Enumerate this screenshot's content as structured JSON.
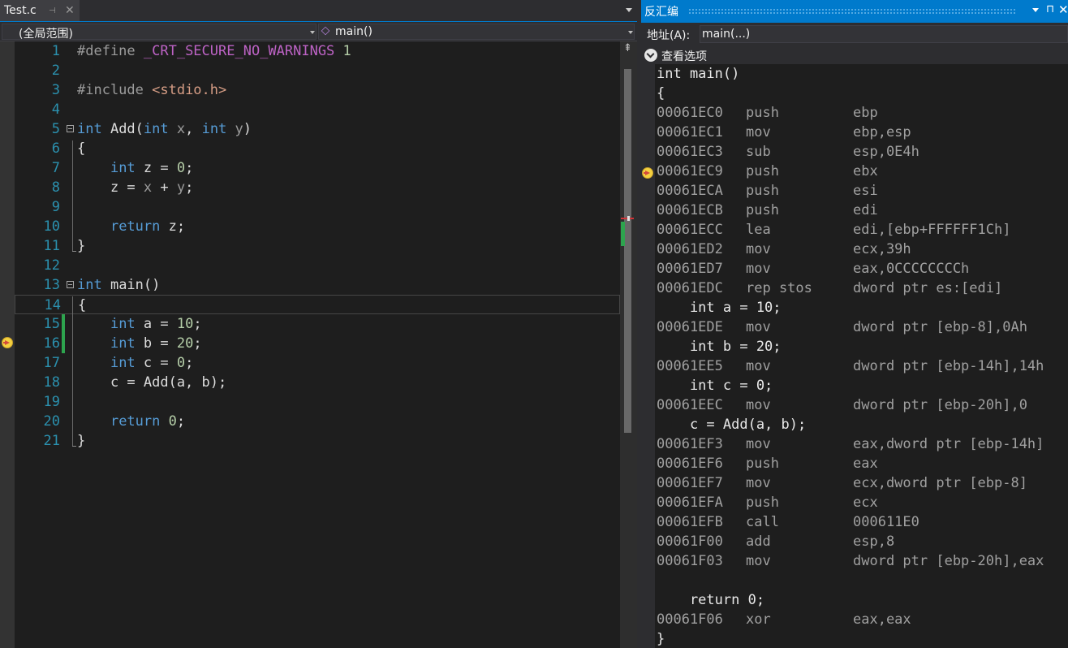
{
  "editor": {
    "tab_title": "Test.c",
    "tab_pin": "⊣",
    "tab_close": "✕",
    "scope_dropdown": "(全局范围)",
    "function_dropdown": "main()",
    "lines": [
      {
        "n": "1",
        "tokens": [
          [
            "pp",
            "#define "
          ],
          [
            "mac",
            "_CRT_SECURE_NO_WARNINGS"
          ],
          [
            "grn",
            " "
          ],
          [
            "n",
            "1"
          ]
        ]
      },
      {
        "n": "2",
        "tokens": []
      },
      {
        "n": "3",
        "tokens": [
          [
            "pp",
            "#include "
          ],
          [
            "str",
            "<stdio.h>"
          ]
        ]
      },
      {
        "n": "4",
        "tokens": []
      },
      {
        "n": "5",
        "fold": true,
        "tokens": [
          [
            "k",
            "int"
          ],
          [
            "grn",
            " Add("
          ],
          [
            "k",
            "int"
          ],
          [
            "p",
            " x"
          ],
          [
            "grn",
            ", "
          ],
          [
            "k",
            "int"
          ],
          [
            "p",
            " y"
          ],
          [
            "grn",
            ")"
          ]
        ]
      },
      {
        "n": "6",
        "tokens": [
          [
            "grn",
            "{"
          ]
        ]
      },
      {
        "n": "7",
        "tokens": [
          [
            "grn",
            "    "
          ],
          [
            "k",
            "int"
          ],
          [
            "grn",
            " z = "
          ],
          [
            "n",
            "0"
          ],
          [
            "grn",
            ";"
          ]
        ]
      },
      {
        "n": "8",
        "tokens": [
          [
            "grn",
            "    z = "
          ],
          [
            "p",
            "x"
          ],
          [
            "grn",
            " + "
          ],
          [
            "p",
            "y"
          ],
          [
            "grn",
            ";"
          ]
        ]
      },
      {
        "n": "9",
        "tokens": []
      },
      {
        "n": "10",
        "tokens": [
          [
            "grn",
            "    "
          ],
          [
            "k",
            "return"
          ],
          [
            "grn",
            " z;"
          ]
        ]
      },
      {
        "n": "11",
        "tokens": [
          [
            "grn",
            "}"
          ]
        ]
      },
      {
        "n": "12",
        "tokens": []
      },
      {
        "n": "13",
        "fold": true,
        "tokens": [
          [
            "k",
            "int"
          ],
          [
            "grn",
            " main()"
          ]
        ]
      },
      {
        "n": "14",
        "current": true,
        "tokens": [
          [
            "grn",
            "{"
          ]
        ]
      },
      {
        "n": "15",
        "changed": true,
        "tokens": [
          [
            "grn",
            "    "
          ],
          [
            "k",
            "int"
          ],
          [
            "grn",
            " a = "
          ],
          [
            "n",
            "10"
          ],
          [
            "grn",
            ";"
          ]
        ]
      },
      {
        "n": "16",
        "changed": true,
        "tokens": [
          [
            "grn",
            "    "
          ],
          [
            "k",
            "int"
          ],
          [
            "grn",
            " b = "
          ],
          [
            "n",
            "20"
          ],
          [
            "grn",
            ";"
          ]
        ]
      },
      {
        "n": "17",
        "tokens": [
          [
            "grn",
            "    "
          ],
          [
            "k",
            "int"
          ],
          [
            "grn",
            " c = "
          ],
          [
            "n",
            "0"
          ],
          [
            "grn",
            ";"
          ]
        ]
      },
      {
        "n": "18",
        "tokens": [
          [
            "grn",
            "    c = Add(a, b);"
          ]
        ]
      },
      {
        "n": "19",
        "tokens": []
      },
      {
        "n": "20",
        "tokens": [
          [
            "grn",
            "    "
          ],
          [
            "k",
            "return"
          ],
          [
            "grn",
            " "
          ],
          [
            "n",
            "0"
          ],
          [
            "grn",
            ";"
          ]
        ]
      },
      {
        "n": "21",
        "tokens": [
          [
            "grn",
            "}"
          ]
        ]
      }
    ]
  },
  "disassembly": {
    "title": "反汇编",
    "address_label": "地址(A):",
    "address_value": "main(...)",
    "options_label": "查看选项",
    "lines": [
      {
        "src": "int main()"
      },
      {
        "src": "{"
      },
      {
        "addr": "00061EC0",
        "mn": "push",
        "op": "ebp"
      },
      {
        "addr": "00061EC1",
        "mn": "mov",
        "op": "ebp,esp"
      },
      {
        "addr": "00061EC3",
        "mn": "sub",
        "op": "esp,0E4h"
      },
      {
        "addr": "00061EC9",
        "mn": "push",
        "op": "ebx"
      },
      {
        "addr": "00061ECA",
        "mn": "push",
        "op": "esi"
      },
      {
        "addr": "00061ECB",
        "mn": "push",
        "op": "edi"
      },
      {
        "addr": "00061ECC",
        "mn": "lea",
        "op": "edi,[ebp+FFFFFF1Ch]"
      },
      {
        "addr": "00061ED2",
        "mn": "mov",
        "op": "ecx,39h"
      },
      {
        "addr": "00061ED7",
        "mn": "mov",
        "op": "eax,0CCCCCCCCh"
      },
      {
        "addr": "00061EDC",
        "mn": "rep stos",
        "op": "dword ptr es:[edi]"
      },
      {
        "src": "    int a = 10;"
      },
      {
        "addr": "00061EDE",
        "mn": "mov",
        "op": "dword ptr [ebp-8],0Ah"
      },
      {
        "src": "    int b = 20;"
      },
      {
        "addr": "00061EE5",
        "mn": "mov",
        "op": "dword ptr [ebp-14h],14h"
      },
      {
        "src": "    int c = 0;"
      },
      {
        "addr": "00061EEC",
        "mn": "mov",
        "op": "dword ptr [ebp-20h],0"
      },
      {
        "src": "    c = Add(a, b);"
      },
      {
        "addr": "00061EF3",
        "mn": "mov",
        "op": "eax,dword ptr [ebp-14h]"
      },
      {
        "addr": "00061EF6",
        "mn": "push",
        "op": "eax"
      },
      {
        "addr": "00061EF7",
        "mn": "mov",
        "op": "ecx,dword ptr [ebp-8]"
      },
      {
        "addr": "00061EFA",
        "mn": "push",
        "op": "ecx"
      },
      {
        "addr": "00061EFB",
        "mn": "call",
        "op": "000611E0"
      },
      {
        "addr": "00061F00",
        "mn": "add",
        "op": "esp,8"
      },
      {
        "addr": "00061F03",
        "mn": "mov",
        "op": "dword ptr [ebp-20h],eax"
      },
      {
        "src": ""
      },
      {
        "src": "    return 0;"
      },
      {
        "addr": "00061F06",
        "mn": "xor",
        "op": "eax,eax"
      },
      {
        "src": "}"
      }
    ]
  },
  "colors": {
    "accent": "#007acc",
    "keyword": "#569cd6",
    "line_number": "#2b91af",
    "macro": "#bd63c5",
    "string": "#d69d85",
    "number": "#b5cea8",
    "change_marker": "#2da44e",
    "instruction_pointer": "#f4d03f"
  },
  "icons": {
    "function_icon": "cube-icon",
    "instruction_pointer": "arrow-circle-icon",
    "options_toggle": "chevron-down-circle-icon"
  }
}
